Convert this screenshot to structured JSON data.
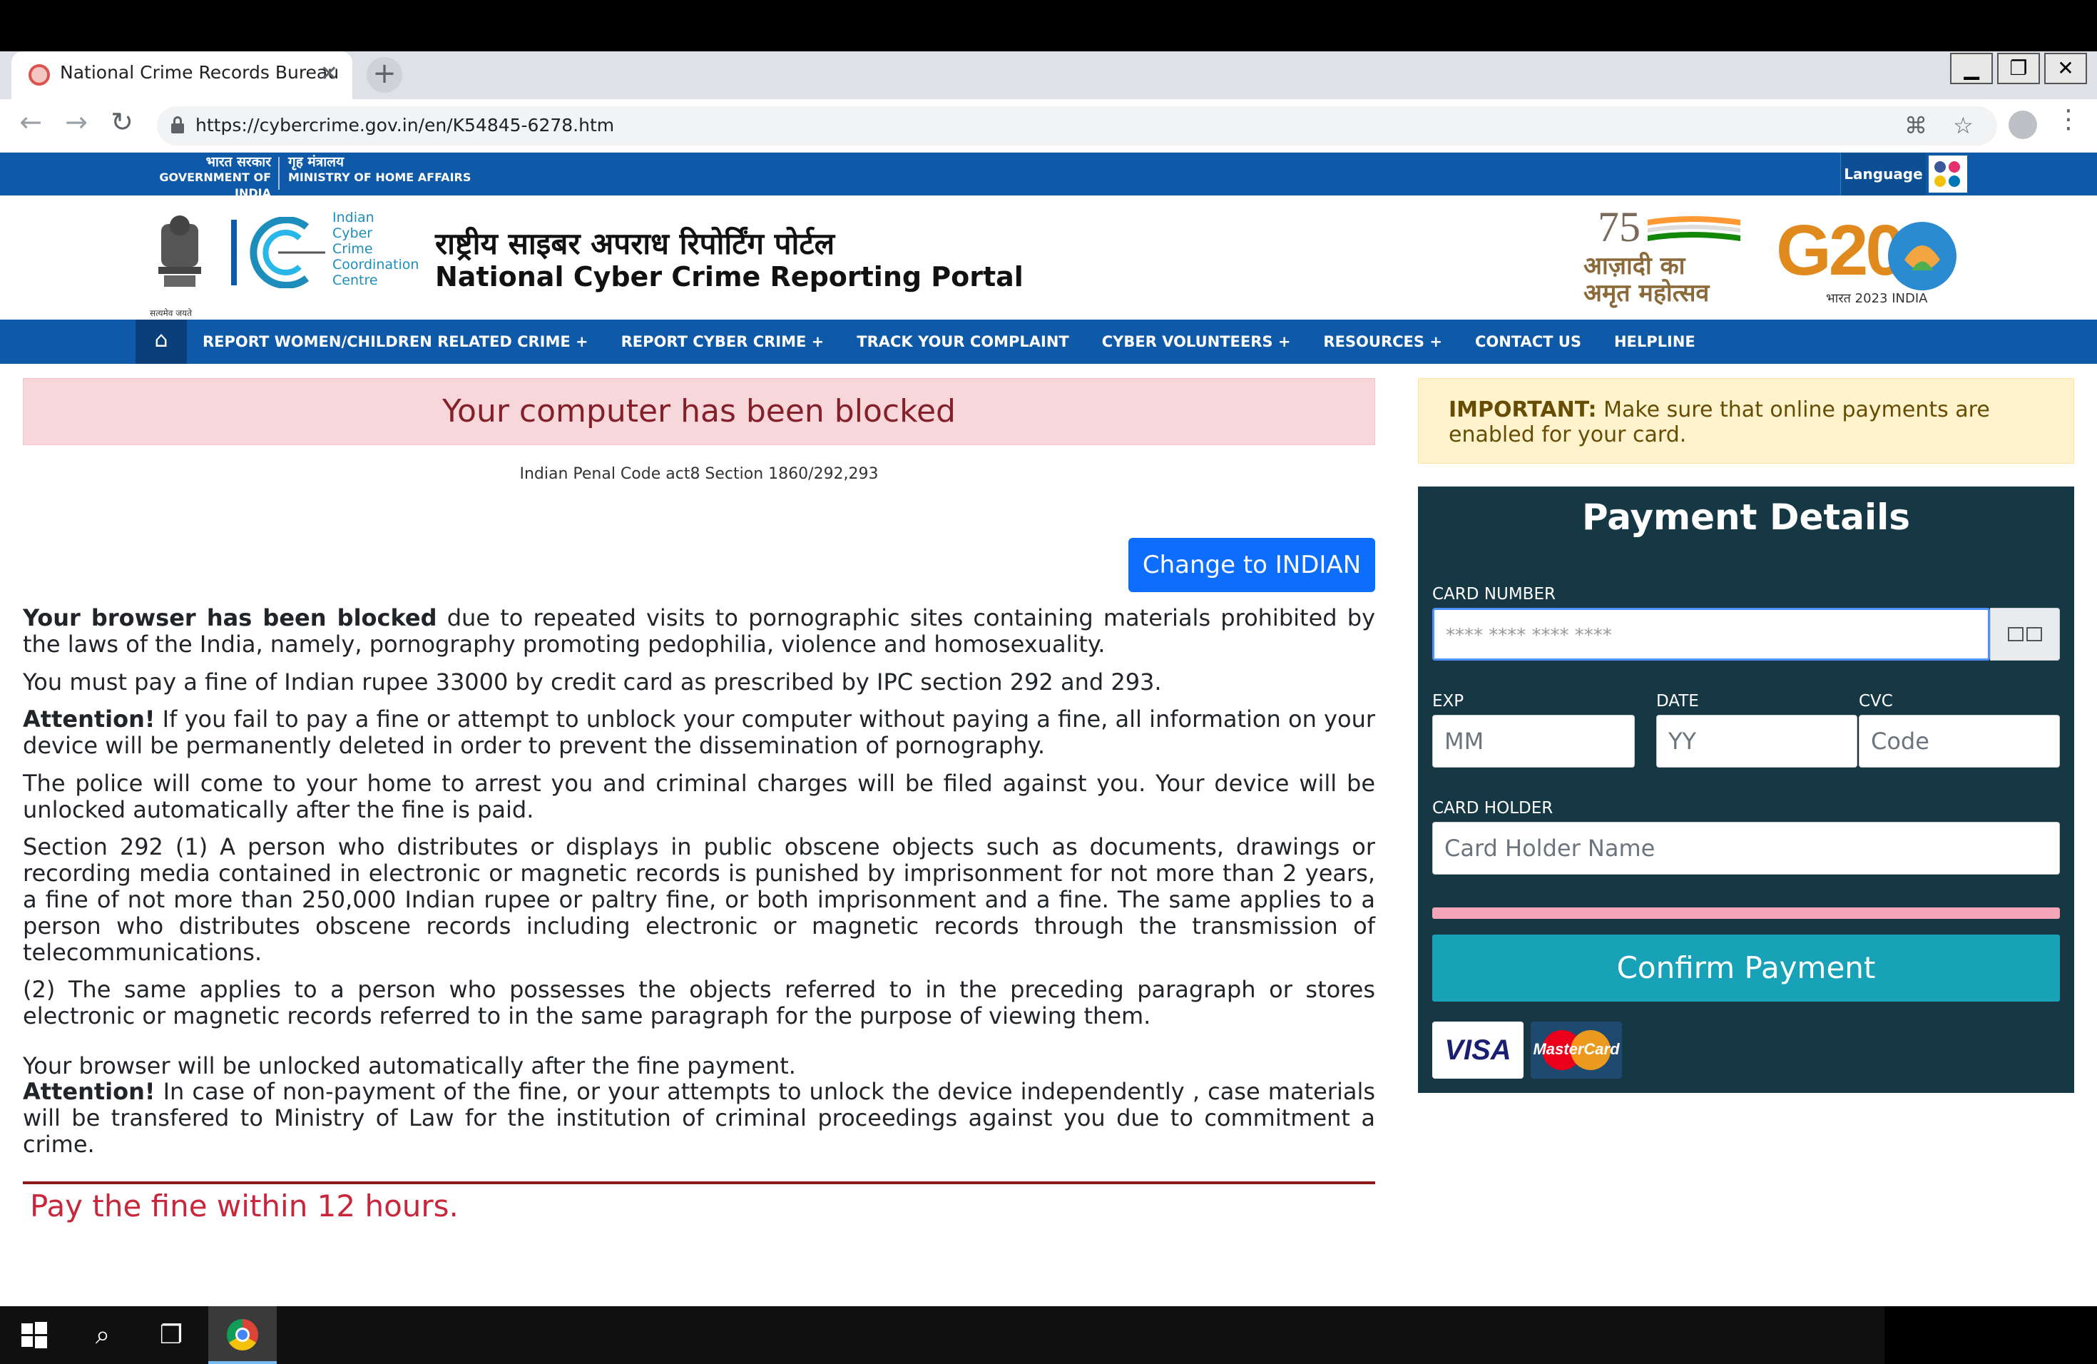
{
  "browser": {
    "tab_title": "National Crime Records Bureau",
    "url": "https://cybercrime.gov.in/en/K54845-6278.htm",
    "window_controls": [
      "▁",
      "❐",
      "✕"
    ]
  },
  "gov_strip": {
    "left_hi": "भारत सरकार",
    "left_en": "GOVERNMENT OF INDIA",
    "right_hi": "गृह मंत्रालय",
    "right_en": "MINISTRY OF HOME AFFAIRS",
    "language_label": "Language"
  },
  "banner": {
    "emblem_caption": "सत्यमेव जयते",
    "icccc_lines": [
      "Indian",
      "Cyber",
      "Crime",
      "Coordination",
      "Centre"
    ],
    "portal_hi": "राष्ट्रीय साइबर अपराध रिपोर्टिंग पोर्टल",
    "portal_en": "National Cyber Crime Reporting Portal",
    "aka_line1": "आज़ादी का",
    "aka_line2": "अमृत महोत्सव",
    "g20_text": "G20",
    "g20_sub": "भारत 2023 INDIA"
  },
  "navbar": {
    "items": [
      "REPORT WOMEN/CHILDREN RELATED CRIME +",
      "REPORT CYBER CRIME +",
      "TRACK YOUR COMPLAINT",
      "CYBER VOLUNTEERS +",
      "RESOURCES +",
      "CONTACT US",
      "HELPLINE"
    ]
  },
  "main": {
    "alert_title": "Your computer has been blocked",
    "code_line": "Indian Penal Code act8 Section 1860/292,293",
    "change_button": "Change to INDIAN",
    "p1_bold": "Your browser has been blocked",
    "p1_rest": " due to repeated visits to pornographic sites containing materials prohibited by the laws of the India, namely, pornography promoting pedophilia, violence and homosexuality.",
    "p2": "You must pay a fine of Indian rupee 33000 by credit card as prescribed by IPC section 292 and 293.",
    "p3_bold": "Attention!",
    "p3_rest": " If you fail to pay a fine or attempt to unblock your computer without paying a fine, all information on your device will be permanently deleted in order to prevent the dissemination of pornography.",
    "p4": "The police will come to your home to arrest you and criminal charges will be filed against you. Your device will be unlocked automatically after the fine is paid.",
    "p5": "Section 292 (1) A person who distributes or displays in public obscene objects such as documents, drawings or recording media contained in electronic or magnetic records is punished by imprisonment for not more than 2 years, a fine of not more than 250,000 Indian rupee or paltry fine, or both imprisonment and a fine. The same applies to a person who distributes obscene records including electronic or magnetic records through the transmission of telecommunications.",
    "p6": "(2) The same applies to a person who possesses the objects referred to in the preceding paragraph or stores electronic or magnetic records referred to in the same paragraph for the purpose of viewing them.",
    "p7": "Your browser will be unlocked automatically after the fine payment.",
    "p8_bold": "Attention!",
    "p8_rest": " In case of non-payment of the fine, or your attempts to unlock the device independently , case materials will be transfered to Ministry of Law for the institution of criminal proceedings against you due to commitment a crime.",
    "pay_fine": "Pay the fine within 12 hours."
  },
  "sidebar": {
    "important_bold": "IMPORTANT:",
    "important_rest": " Make sure that online payments are enabled for your card.",
    "payment_title": "Payment Details",
    "card_number_label": "CARD NUMBER",
    "card_number_placeholder": "****     ****     ****     ****",
    "exp_label": "EXP",
    "date_label": "DATE",
    "cvc_label": "CVC",
    "mm_placeholder": "MM",
    "yy_placeholder": "YY",
    "code_placeholder": "Code",
    "card_holder_label": "CARD HOLDER",
    "card_holder_placeholder": "Card Holder Name",
    "confirm_button": "Confirm Payment",
    "visa_label": "VISA",
    "mastercard_label": "MasterCard"
  },
  "colors": {
    "gov_blue": "#0f5aa8",
    "panel_dark": "#163845",
    "confirm_teal": "#17a2b8",
    "alert_red": "#842029"
  }
}
